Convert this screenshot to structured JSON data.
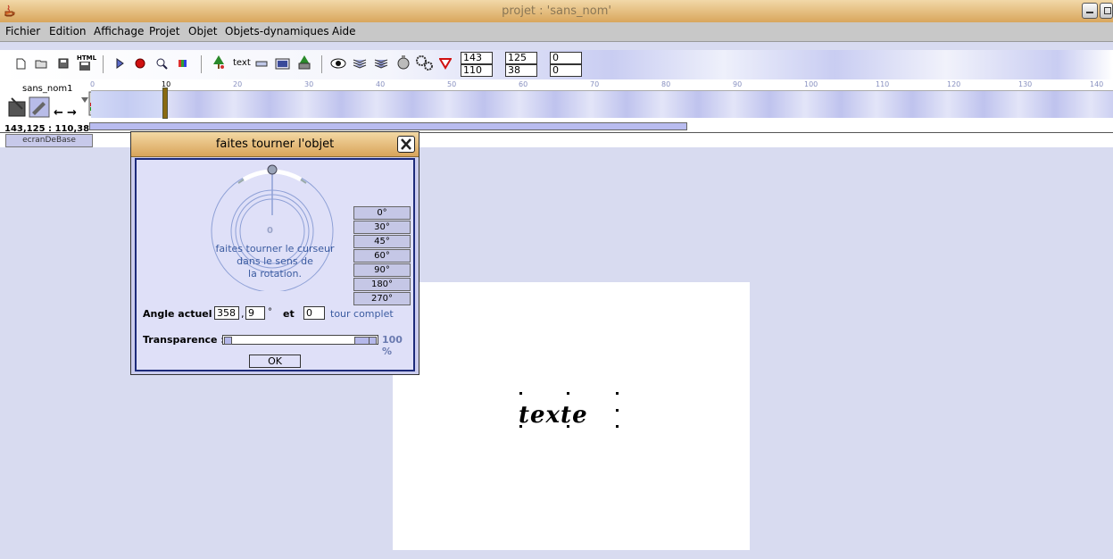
{
  "window": {
    "title": "projet : 'sans_nom'"
  },
  "menu": [
    "Fichier",
    "Edition",
    "Affichage",
    "Projet",
    "Objet",
    "Objets-dynamiques",
    "Aide"
  ],
  "toolbar": {
    "text_tool_label": "text",
    "html_label": "HTML",
    "pos_x": "143",
    "pos_y": "110",
    "width": "125",
    "height": "38",
    "field_a": "0",
    "field_b": "0"
  },
  "timeline": {
    "scene_name": "sans_nom1",
    "coords": "143,125 : 110,38",
    "ruler": [
      "0",
      "10",
      "20",
      "30",
      "40",
      "50",
      "60",
      "70",
      "80",
      "90",
      "100",
      "110",
      "120",
      "130",
      "140"
    ],
    "tab": "ecranDeBase"
  },
  "canvas": {
    "text": "texte"
  },
  "dialog": {
    "title": "faites tourner l'objet",
    "dial_value": "0",
    "instruction_1": "faites tourner le curseur",
    "instruction_2": "dans le sens de",
    "instruction_3": "la rotation.",
    "presets": [
      "0°",
      "30°",
      "45°",
      "60°",
      "90°",
      "180°",
      "270°"
    ],
    "angle_label": "Angle actuel :",
    "angle_int": "358",
    "angle_sep": ",",
    "angle_dec": "9",
    "degree": "°",
    "and": "et",
    "turns": "0",
    "turns_label": "tour complet",
    "transparency_label": "Transparence :",
    "transparency": 1.0,
    "transparency_value": "100 %",
    "ok": "OK"
  }
}
